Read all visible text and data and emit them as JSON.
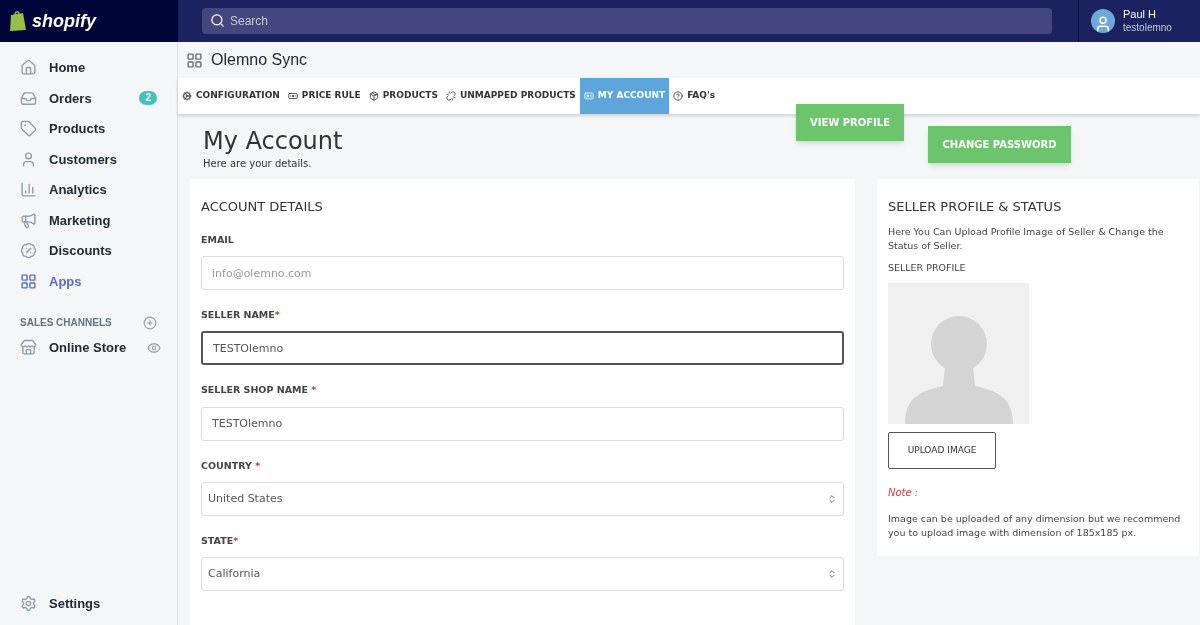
{
  "topbar": {
    "logo": "shopify",
    "search": {
      "placeholder": "Search"
    },
    "user": {
      "name": "Paul H",
      "store": "testolemno"
    }
  },
  "sidebar": {
    "items": [
      {
        "label": "Home",
        "selected": false
      },
      {
        "label": "Orders",
        "selected": false,
        "badge": "2"
      },
      {
        "label": "Products",
        "selected": false
      },
      {
        "label": "Customers",
        "selected": false
      },
      {
        "label": "Analytics",
        "selected": false
      },
      {
        "label": "Marketing",
        "selected": false
      },
      {
        "label": "Discounts",
        "selected": false
      },
      {
        "label": "Apps",
        "selected": true
      }
    ],
    "section": "SALES CHANNELS",
    "channels": [
      {
        "label": "Online Store",
        "selected": false
      }
    ],
    "settings": "Settings"
  },
  "app": {
    "title": "Olemno Sync",
    "tabs": [
      {
        "label": "CONFIGURATION",
        "selected": false
      },
      {
        "label": "PRICE RULE",
        "selected": false
      },
      {
        "label": "PRODUCTS",
        "selected": false
      },
      {
        "label": "UNMAPPED PRODUCTS",
        "selected": false
      },
      {
        "label": "MY ACCOUNT",
        "selected": true
      },
      {
        "label": "FAQ's",
        "selected": false
      }
    ],
    "view_profile": "VIEW PROFILE",
    "change_password": "CHANGE PASSWORD",
    "heading": "My Account",
    "subheading": "Here are your details.",
    "account": {
      "title": "ACCOUNT DETAILS",
      "fields": [
        {
          "kind": "text",
          "label": "EMAIL",
          "placeholder": "info@olemno.com",
          "focused": false
        },
        {
          "kind": "text",
          "label": "SELLER NAME",
          "mark": "*",
          "value": "TESTOlemno",
          "focused": true
        },
        {
          "kind": "text",
          "label": "SELLER SHOP NAME ",
          "mark": "*",
          "value": "TESTOlemno",
          "focused": false
        },
        {
          "kind": "select",
          "label": "COUNTRY ",
          "mark": "*",
          "value": "United States",
          "focused": false
        },
        {
          "kind": "select",
          "label": "STATE",
          "mark": "*",
          "value": "California",
          "focused": false
        }
      ]
    },
    "profile": {
      "title": "SELLER PROFILE & STATUS",
      "description": "Here You Can Upload Profile Image of Seller & Change the Status of Seller.",
      "label": "SELLER PROFILE",
      "upload": "UPLOAD IMAGE",
      "note_label": "Note :",
      "note": "Image can be uploaded of any dimension but we recommend you to upload image with dimension of 185x185 px."
    }
  }
}
